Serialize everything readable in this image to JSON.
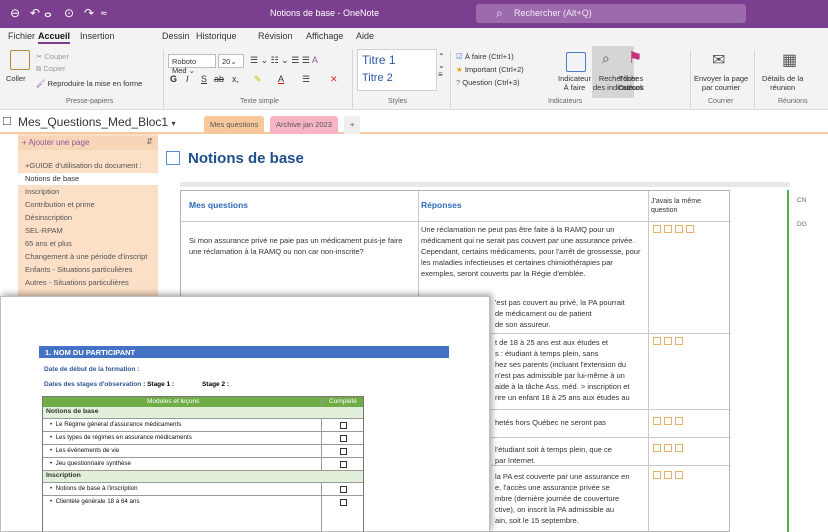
{
  "titlebar": {
    "title": "Notions de base - OneNote",
    "search_placeholder": "Rechercher (Alt+Q)"
  },
  "menu": [
    "Fichier",
    "Accueil",
    "Insertion",
    "Dessin",
    "Historique",
    "Révision",
    "Affichage",
    "Aide"
  ],
  "ribbon": {
    "clipboard": {
      "cut": "Couper",
      "copy": "Copier",
      "paste": "Coller",
      "format_painter": "Reproduire la mise en forme",
      "label": "Presse-papiers"
    },
    "text": {
      "font": "Roboto Med",
      "size": "20",
      "label": "Texte simple"
    },
    "styles": {
      "title1": "Titre 1",
      "title2": "Titre 2",
      "label": "Styles"
    },
    "tags": {
      "todo": "À faire (Ctrl+1)",
      "important": "Important (Ctrl+2)",
      "question": "Question (Ctrl+3)",
      "indicator_todo": "Indicateur\nÀ faire",
      "find_indicators": "Rechercher\ndes indicateurs",
      "outlook_tasks": "Tâches\nOutlook",
      "label": "Indicateurs"
    },
    "mail": {
      "send": "Envoyer la page\npar courrier",
      "label": "Courrier"
    },
    "meetings": {
      "details": "Détails de la\nréunion",
      "label": "Réunions"
    }
  },
  "notebook": {
    "name": "Mes_Questions_Med_Bloc1",
    "tabs": [
      "Mes questions",
      "Archive jan 2023",
      "+"
    ]
  },
  "pages": {
    "add": "Ajouter une page",
    "items": [
      "+GUIDE d'utilisation du document :",
      "Notions de base",
      "Inscription",
      "Contribution et prime",
      "Désinscription",
      "SEL-RPAM",
      "65 ans et plus",
      "Changement à une période d'inscript",
      "Enfants - Situations particulières",
      "Autres - Situations particulières"
    ]
  },
  "page": {
    "title": "Notions de base",
    "col_questions": "Mes questions",
    "col_answers": "Réponses",
    "col_same": "J'avais la même question",
    "q1": "Si mon assurance privé ne paie pas un médicament puis-je faire une réclamation à la RAMQ ou non car non-inscrite?",
    "a1": "Une réclamation ne peut pas être faite à la RAMQ pour un médicament qui ne serait pas couvert par une assurance privée. Cependant, certains médicaments, pour l'arrêt de grossesse, pour les maladies infectieuses et certaines chimiothérapies par exemples, seront couverts par la Régie d'emblée.",
    "a2": [
      "'est pas couvert au privé, la PA pourrait",
      "de médicament ou de patient",
      "de son assureur."
    ],
    "a3": [
      "t de 18 à 25 ans est aux études et",
      "s : étudiant à temps plein, sans",
      "hez ses parents (incluant l'extension du",
      "n'est pas admissible par lui-même à un",
      "aide à la tâche Ass. méd. > inscription et",
      "rire un enfant 18 à 25 ans aux études au"
    ],
    "a4": [
      "hetés hors Québec ne seront pas"
    ],
    "a5": [
      "l'étudiant soit à temps plein, que ce",
      "par Internet."
    ],
    "a6": [
      "la PA est couverte par une assurance en",
      "e, l'accès une assurance privée se",
      "mbre (dernière journée de couverture",
      "ctive), on inscrit la PA admissible au",
      "ain, soit le 15 septembre."
    ],
    "side_cn": "CN",
    "side_dg": "DG"
  },
  "doc": {
    "heading": "1.   NOM DU PARTICIPANT",
    "start_date": "Date de début de la formation :",
    "stage_dates": "Dates des stages d'observation",
    "stage1": ": Stage 1 :",
    "stage2": "Stage 2 :",
    "table_head_modules": "Modules et leçons",
    "table_head_done": "Complété",
    "sections": [
      {
        "name": "Notions de base",
        "items": [
          "Le Régime général d'assurance médicaments",
          "Les types de régimes en assurance médicaments",
          "Les événements de vie",
          "Jeu questionnaire synthèse"
        ]
      },
      {
        "name": "Inscription",
        "items": [
          "Notions de base à l'inscription",
          "Clientèle générale 18 à 64 ans"
        ]
      }
    ]
  }
}
